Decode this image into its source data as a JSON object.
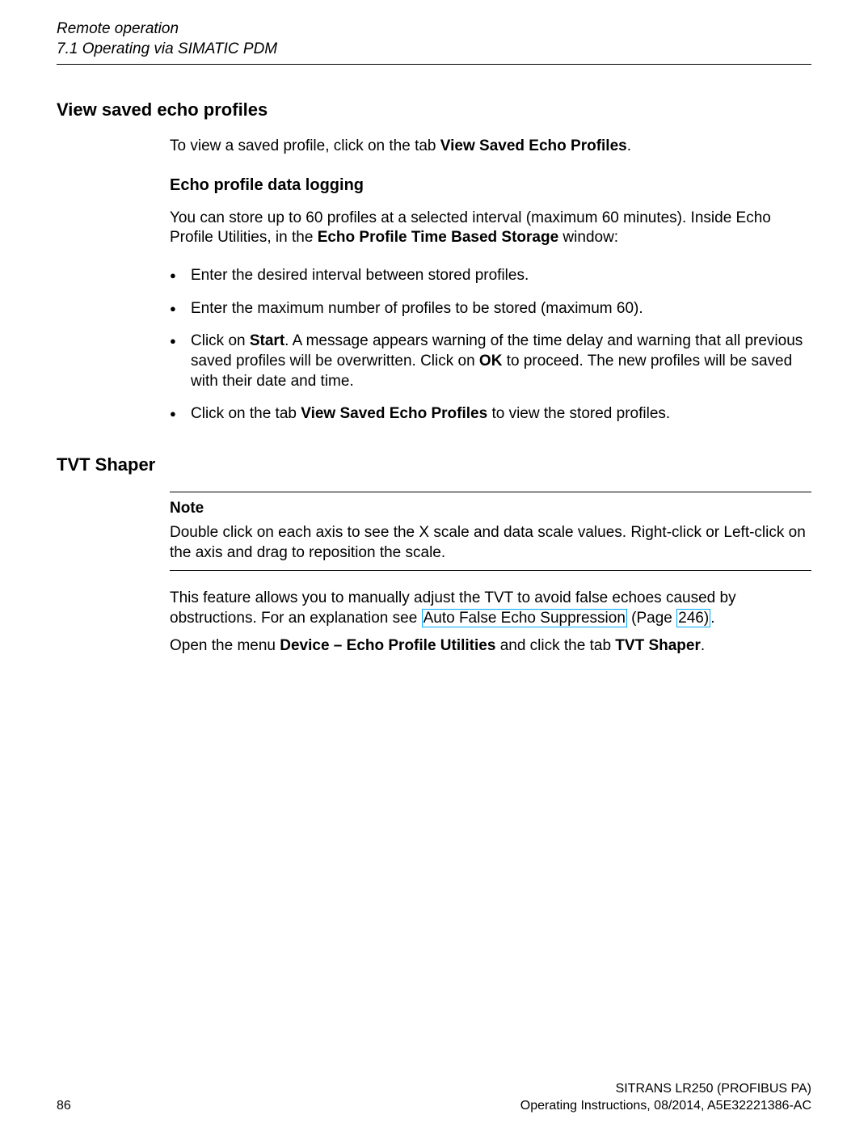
{
  "header": {
    "chapter": "Remote operation",
    "section": "7.1 Operating via SIMATIC PDM"
  },
  "h1_view_saved": "View saved echo profiles",
  "p_view_saved_pre": "To view a saved profile, click on the tab ",
  "p_view_saved_bold": "View Saved Echo Profiles",
  "p_view_saved_post": ".",
  "h2_logging": "Echo profile data logging",
  "p_logging_pre": "You can store up to 60 profiles at a selected interval (maximum 60 minutes). Inside Echo Profile Utilities, in the ",
  "p_logging_bold": "Echo Profile Time Based Storage",
  "p_logging_post": " window:",
  "bullets": {
    "b1": "Enter the desired interval between stored profiles.",
    "b2": "Enter the maximum number of profiles to be stored (maximum 60).",
    "b3_pre": "Click on ",
    "b3_start": "Start",
    "b3_mid": ". A message appears warning of the time delay and warning that all previous saved profiles will be overwritten. Click on ",
    "b3_ok": "OK",
    "b3_post": " to proceed. The new profiles will be saved with their date and time.",
    "b4_pre": "Click on the tab ",
    "b4_bold": "View Saved Echo Profiles",
    "b4_post": " to view the stored profiles."
  },
  "h1_tvt": "TVT Shaper",
  "note": {
    "title": "Note",
    "body": "Double click on each axis to see the X scale and data scale values. Right-click or Left-click on the axis and drag to reposition the scale."
  },
  "p_tvt1_pre": "This feature allows you to manually adjust the TVT to avoid false echoes caused by obstructions. For an explanation see ",
  "xref_text": "Auto False Echo Suppression",
  "p_tvt1_mid": " (Page ",
  "xref_page": "246)",
  "p_tvt1_post": ".",
  "p_tvt2_pre": "Open the menu ",
  "p_tvt2_bold1": "Device – Echo Profile Utilities",
  "p_tvt2_mid": " and click the tab ",
  "p_tvt2_bold2": "TVT Shaper",
  "p_tvt2_post": ".",
  "footer": {
    "product": "SITRANS LR250 (PROFIBUS PA)",
    "docinfo": "Operating Instructions, 08/2014, A5E32221386-AC",
    "page": "86"
  }
}
